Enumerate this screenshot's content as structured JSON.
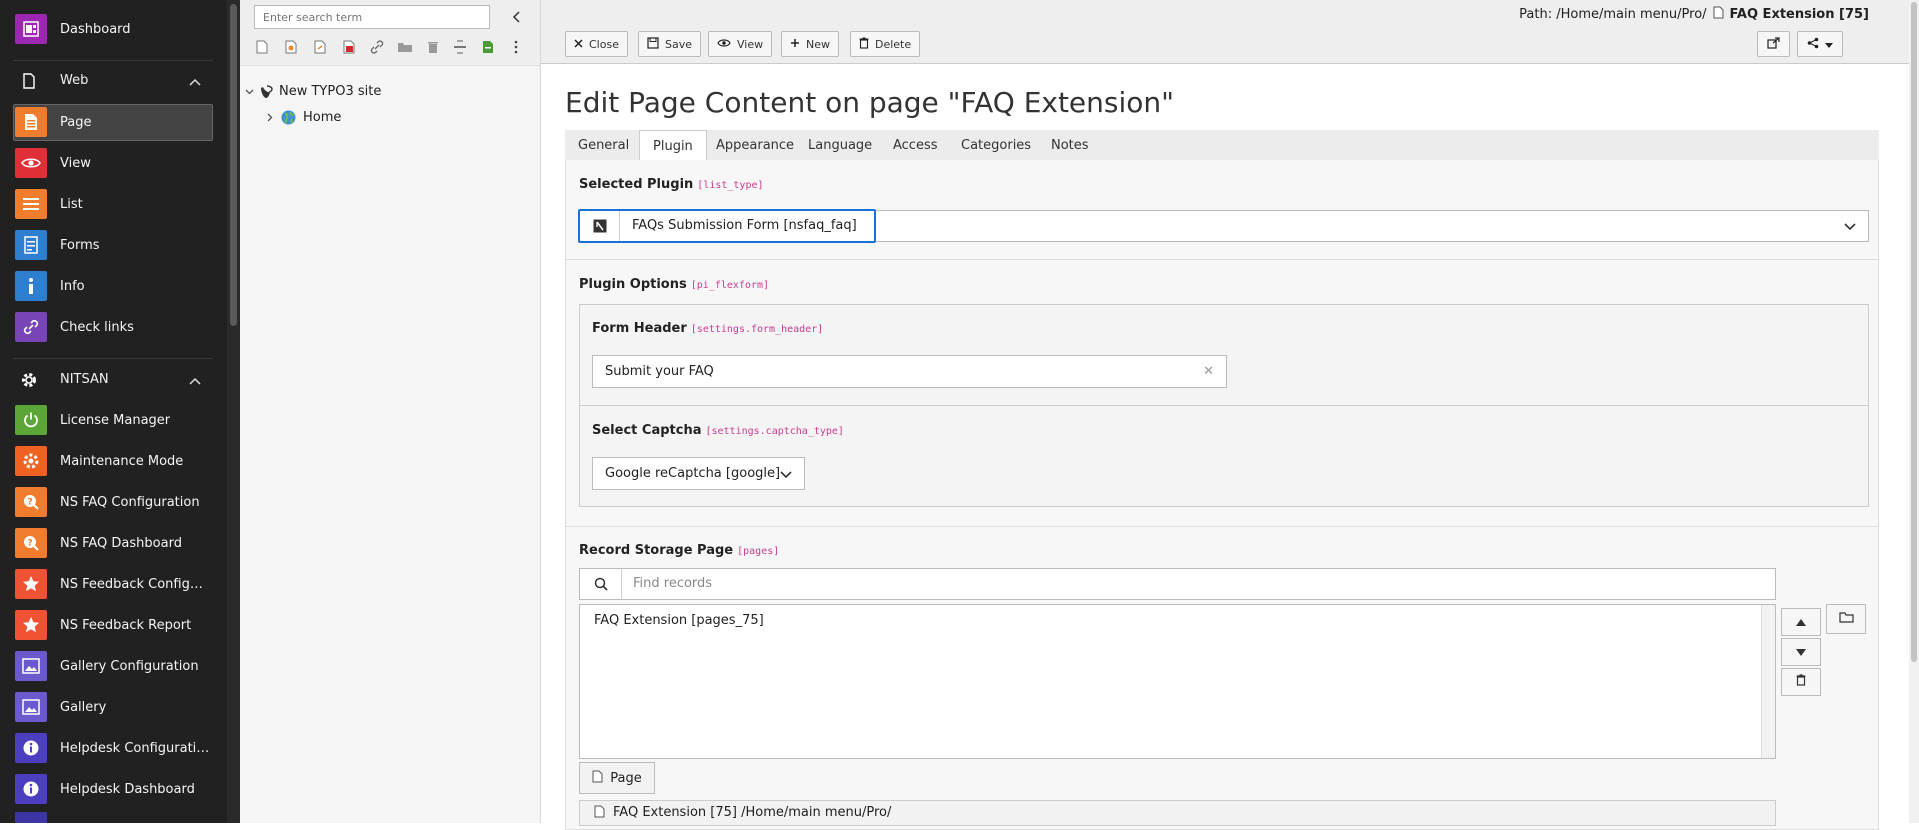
{
  "module_menu": {
    "top": {
      "label": "Dashboard"
    },
    "groups": [
      {
        "label": "Web",
        "items": [
          "Page",
          "View",
          "List",
          "Forms",
          "Info",
          "Check links"
        ]
      },
      {
        "label": "NITSAN",
        "items": [
          "License Manager",
          "Maintenance Mode",
          "NS FAQ Configuration",
          "NS FAQ Dashboard",
          "NS Feedback Configur...",
          "NS Feedback Report",
          "Gallery Configuration",
          "Gallery",
          "Helpdesk Configuration",
          "Helpdesk Dashboard"
        ]
      }
    ],
    "active": "Page",
    "colors": {
      "dashboard": "#9c27b0",
      "page": "#f07d2d",
      "view": "#e02f36",
      "list": "#f07d2d",
      "forms": "#2f7fd1",
      "info": "#2f7fd1",
      "check_links": "#7845b7",
      "license": "#5ca539",
      "maintenance": "#f06222",
      "faq": "#f07d2d",
      "feedback": "#f05233",
      "gallery": "#6a5acd",
      "helpdesk": "#4b3fbf"
    }
  },
  "page_tree": {
    "search_placeholder": "Enter search term",
    "site_label": "New TYPO3 site",
    "home_label": "Home"
  },
  "docheader": {
    "buttons": {
      "close": "Close",
      "save": "Save",
      "view": "View",
      "new": "New",
      "delete": "Delete"
    },
    "path_prefix": "Path: /Home/main menu/Pro/",
    "path_page": "FAQ Extension [75]"
  },
  "form": {
    "title": "Edit Page Content on page \"FAQ Extension\"",
    "tabs": [
      "General",
      "Plugin",
      "Appearance",
      "Language",
      "Access",
      "Categories",
      "Notes"
    ],
    "active_tab": "Plugin",
    "selected_plugin": {
      "label": "Selected Plugin",
      "code": "[list_type]",
      "value": "FAQs Submission Form [nsfaq_faq]"
    },
    "plugin_options": {
      "label": "Plugin Options",
      "code": "[pi_flexform]"
    },
    "form_header": {
      "label": "Form Header",
      "code": "[settings.form_header]",
      "value": "Submit your FAQ"
    },
    "captcha": {
      "label": "Select Captcha",
      "code": "[settings.captcha_type]",
      "value": "Google reCaptcha [google]"
    },
    "storage": {
      "label": "Record Storage Page",
      "code": "[pages]",
      "find_placeholder": "Find records",
      "selected": "FAQ Extension [pages_75]",
      "page_button": "Page",
      "row_text": "FAQ Extension [75] /Home/main menu/Pro/"
    }
  }
}
